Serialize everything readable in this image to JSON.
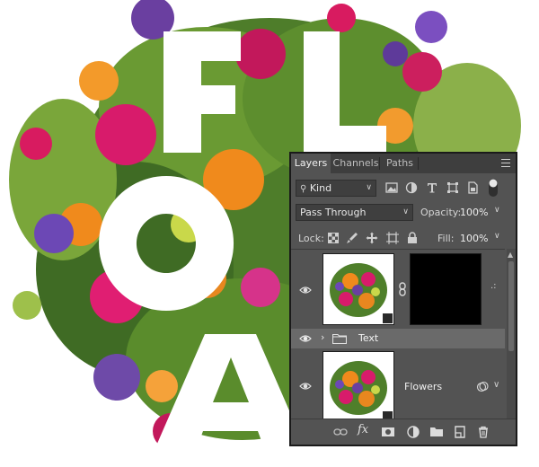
{
  "canvas": {
    "letters": [
      "F",
      "L",
      "O",
      "A"
    ]
  },
  "panel": {
    "tabs": [
      "Layers",
      "Channels",
      "Paths"
    ],
    "active_tab": "Layers",
    "filter_kind": "Kind",
    "blend_mode": "Pass Through",
    "opacity_label": "Opacity:",
    "opacity_value": "100%",
    "lock_label": "Lock:",
    "fill_label": "Fill:",
    "fill_value": "100%",
    "layers": [
      {
        "name": "",
        "type": "adjustment-with-mask",
        "visible": true
      },
      {
        "name": "Text",
        "type": "group",
        "visible": true,
        "selected": true
      },
      {
        "name": "Flowers",
        "type": "smart-object",
        "visible": true
      }
    ],
    "colors": {
      "panel_bg": "#535353",
      "tab_bar": "#3e3e3e",
      "selected_row": "#6a6a6a",
      "field_bg": "#3f3f3f"
    }
  }
}
